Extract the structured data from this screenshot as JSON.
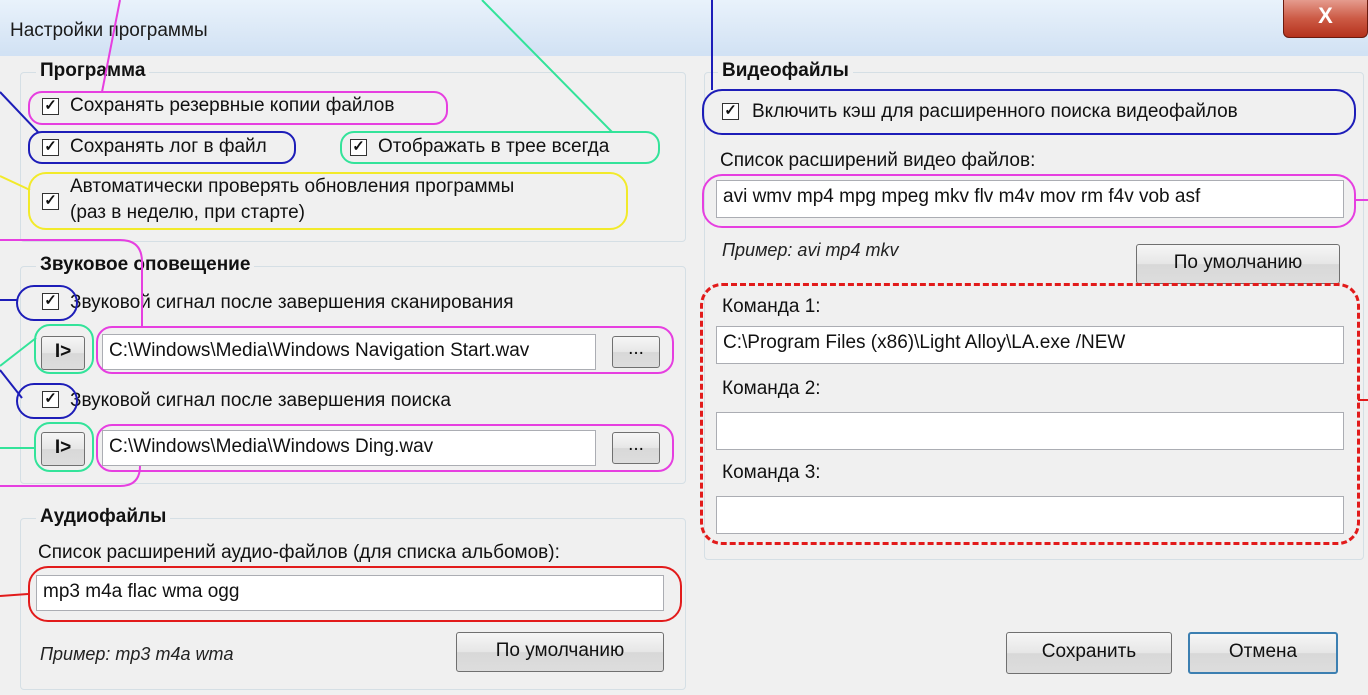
{
  "window": {
    "title": "Настройки программы",
    "close_label": "X"
  },
  "program": {
    "legend": "Программа",
    "backup_label": "Сохранять резервные копии файлов",
    "log_label": "Сохранять лог в файл",
    "tray_label": "Отображать в трее всегда",
    "update_line1": "Автоматически проверять обновления программы",
    "update_line2": "(раз в неделю, при старте)"
  },
  "sound": {
    "legend": "Звуковое оповещение",
    "scan_label": "Звуковой сигнал после завершения сканирования",
    "scan_file": "C:\\Windows\\Media\\Windows Navigation Start.wav",
    "search_label": "Звуковой сигнал после завершения поиска",
    "search_file": "C:\\Windows\\Media\\Windows Ding.wav",
    "play_label": "I>",
    "browse_label": "..."
  },
  "audio": {
    "legend": "Аудиофайлы",
    "list_label": "Список расширений аудио-файлов (для списка альбомов):",
    "extensions": "mp3 m4a flac wma ogg",
    "example": "Пример: mp3 m4a wma",
    "default_label": "По умолчанию"
  },
  "video": {
    "legend": "Видеофайлы",
    "cache_label": "Включить кэш для расширенного поиска видеофайлов",
    "list_label": "Список расширений видео файлов:",
    "extensions": "avi wmv mp4 mpg mpeg mkv flv m4v mov rm f4v vob asf",
    "example": "Пример: avi mp4 mkv",
    "default_label": "По умолчанию",
    "cmd1_label": "Команда 1:",
    "cmd1_value": "C:\\Program Files (x86)\\Light Alloy\\LA.exe /NEW",
    "cmd2_label": "Команда 2:",
    "cmd2_value": "",
    "cmd3_label": "Команда 3:",
    "cmd3_value": ""
  },
  "footer": {
    "save_label": "Сохранить",
    "cancel_label": "Отмена"
  },
  "checkbox_mark": "☑",
  "annotation_colors": {
    "pink": "#e63fe0",
    "blue": "#1d1db8",
    "green": "#33e39a",
    "yellow": "#f2ea2a",
    "red": "#e21b1b"
  }
}
